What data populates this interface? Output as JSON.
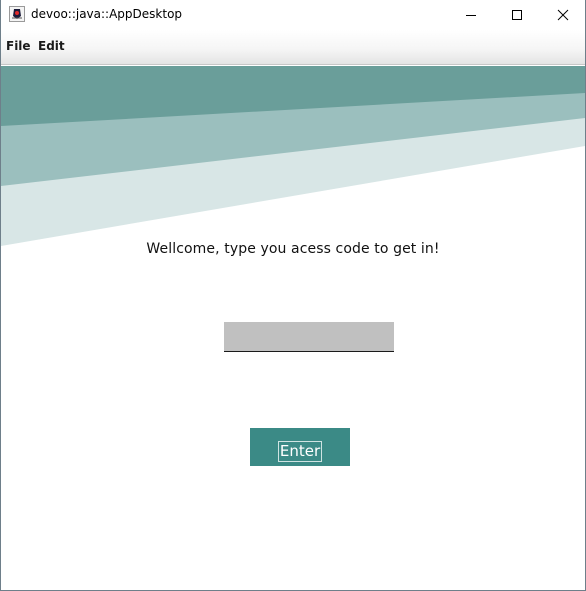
{
  "window": {
    "title": "devoo::java::AppDesktop",
    "app_icon": "java-duke-icon",
    "controls": {
      "minimize_icon": "minimize-icon",
      "maximize_icon": "maximize-icon",
      "close_icon": "close-icon"
    }
  },
  "menubar": {
    "items": [
      {
        "label": "File"
      },
      {
        "label": "Edit"
      }
    ]
  },
  "banner": {
    "colors": [
      "#6a9e9a",
      "#9bbfbe",
      "#d8e6e6"
    ]
  },
  "login": {
    "welcome_text": "Wellcome, type you acess code to get in!",
    "code_input": {
      "value": "",
      "placeholder": ""
    },
    "enter_label": "Enter"
  },
  "colors": {
    "accent": "#3b8a86",
    "input_bg": "#c0c0c0"
  }
}
